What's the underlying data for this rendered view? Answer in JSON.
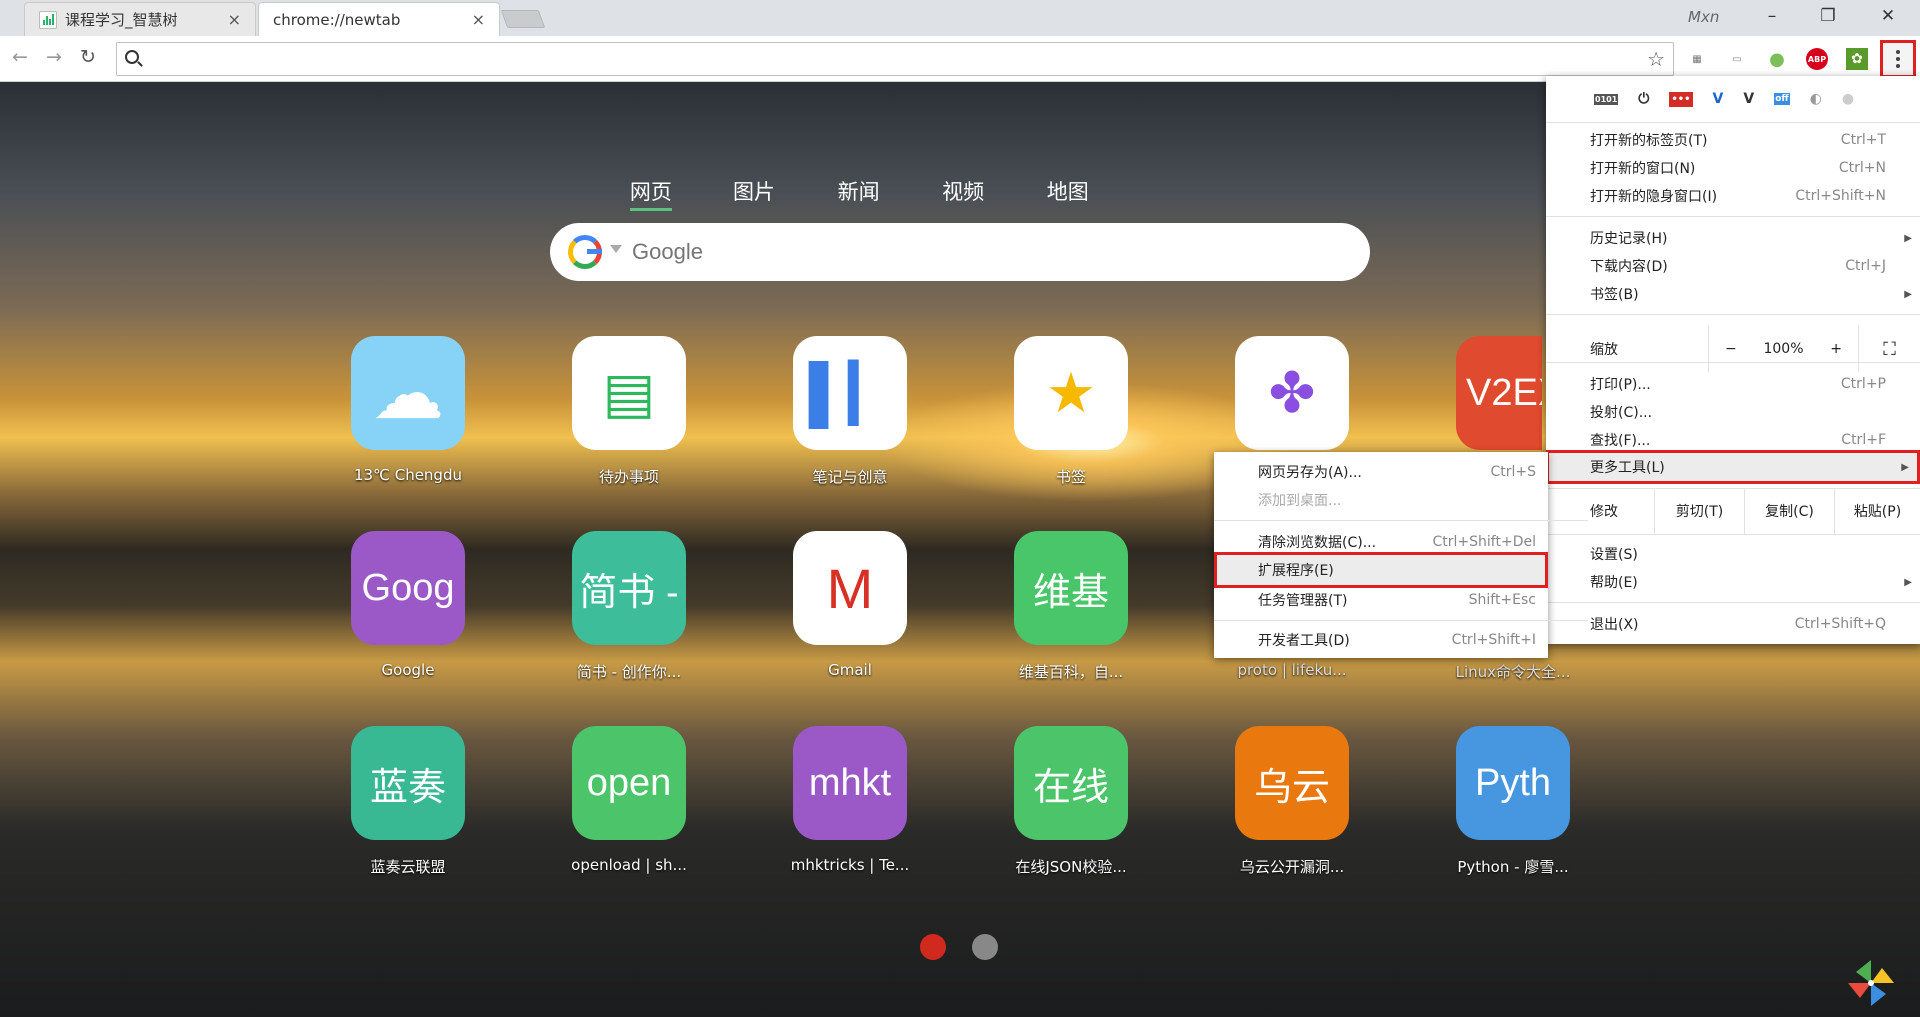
{
  "tabs": [
    {
      "title": "课程学习_智慧树",
      "close": "×"
    },
    {
      "title": "chrome://newtab",
      "close": "×"
    }
  ],
  "window": {
    "user": "Mxn",
    "minimize": "–",
    "restore": "❐",
    "close": "✕"
  },
  "toolbar": {
    "back": "←",
    "forward": "→",
    "reload": "↻",
    "address_value": "",
    "star": "☆",
    "extensions": [
      {
        "name": "reader-icon",
        "text": "▦",
        "color": "#777"
      },
      {
        "name": "window-icon",
        "text": "▭",
        "color": "#888"
      },
      {
        "name": "circle-extension-icon",
        "text": "●",
        "color": "#7cbf5a"
      },
      {
        "name": "adblock-plus-icon",
        "text": "ABP",
        "color": "#d6001c"
      },
      {
        "name": "bamboo-icon",
        "text": "✿",
        "color": "#5a9a2a"
      }
    ]
  },
  "search": {
    "tabs": [
      "网页",
      "图片",
      "新闻",
      "视频",
      "地图"
    ],
    "placeholder": "Google"
  },
  "tiles": [
    {
      "name": "weather-tile",
      "text": "☁",
      "label": "13℃ Chengdu",
      "bg": "#86d3f7"
    },
    {
      "name": "todo-tile",
      "text": "▤",
      "label": "待办事项",
      "bg": "#ffffff",
      "fg": "#2db85c"
    },
    {
      "name": "notes-tile",
      "text": "▌▎",
      "label": "笔记与创意",
      "bg": "#ffffff",
      "fg": "#3b7ee8"
    },
    {
      "name": "bookmarks-tile",
      "text": "★",
      "label": "书签",
      "bg": "#ffffff",
      "fg": "#f6b900"
    },
    {
      "name": "apps-tile",
      "text": "✤",
      "label": "",
      "bg": "#ffffff",
      "fg": "#8a4fe0"
    },
    {
      "name": "v2ex-tile",
      "text": "V2EX",
      "label": "",
      "bg": "#e04a2e"
    },
    {
      "name": "google-tile",
      "text": "Goog",
      "label": "Google",
      "bg": "#9a59c7"
    },
    {
      "name": "jianshu-tile",
      "text": "简书 -",
      "label": "简书 - 创作你...",
      "bg": "#3dbd9a"
    },
    {
      "name": "gmail-tile",
      "text": "M",
      "label": "Gmail",
      "bg": "#ffffff",
      "fg": "#d93025"
    },
    {
      "name": "wiki-tile",
      "text": "维基",
      "label": "维基百科，自...",
      "bg": "#49c66a"
    },
    {
      "name": "proto-tile",
      "text": "",
      "label": "proto | lifeku...",
      "bg": "transparent"
    },
    {
      "name": "linux-tile",
      "text": "",
      "label": "Linux命令大全...",
      "bg": "transparent"
    },
    {
      "name": "lanzou-tile",
      "text": "蓝奏",
      "label": "蓝奏云联盟",
      "bg": "#39b894"
    },
    {
      "name": "openload-tile",
      "text": "open",
      "label": "openload | sh...",
      "bg": "#4cc46a"
    },
    {
      "name": "mhkt-tile",
      "text": "mhkt",
      "label": "mhktricks | Te...",
      "bg": "#9a59c7"
    },
    {
      "name": "json-tile",
      "text": "在线",
      "label": "在线JSON校验...",
      "bg": "#4cc46a"
    },
    {
      "name": "wooyun-tile",
      "text": "乌云",
      "label": "乌云公开漏洞...",
      "bg": "#e9780e"
    },
    {
      "name": "python-tile",
      "text": "Pyth",
      "label": "Python - 廖雪...",
      "bg": "#4797e0"
    }
  ],
  "pager": {
    "active_color": "#d02a1f",
    "inactive_color": "#888888"
  },
  "menu": {
    "top_icons": [
      "0101",
      "⏻",
      "•••",
      "V",
      "V",
      "off",
      "◐",
      "●"
    ],
    "new_tab": {
      "label": "打开新的标签页(T)",
      "shortcut": "Ctrl+T"
    },
    "new_window": {
      "label": "打开新的窗口(N)",
      "shortcut": "Ctrl+N"
    },
    "incognito": {
      "label": "打开新的隐身窗口(I)",
      "shortcut": "Ctrl+Shift+N"
    },
    "history": {
      "label": "历史记录(H)"
    },
    "downloads": {
      "label": "下载内容(D)",
      "shortcut": "Ctrl+J"
    },
    "bookmarks": {
      "label": "书签(B)"
    },
    "zoom": {
      "label": "缩放",
      "minus": "−",
      "value": "100%",
      "plus": "+",
      "fullscreen": "⛶"
    },
    "print": {
      "label": "打印(P)...",
      "shortcut": "Ctrl+P"
    },
    "cast": {
      "label": "投射(C)..."
    },
    "find": {
      "label": "查找(F)...",
      "shortcut": "Ctrl+F"
    },
    "more_tools": {
      "label": "更多工具(L)"
    },
    "edit": {
      "label": "修改",
      "cut": "剪切(T)",
      "copy": "复制(C)",
      "paste": "粘贴(P)"
    },
    "settings": {
      "label": "设置(S)"
    },
    "help": {
      "label": "帮助(E)"
    },
    "exit": {
      "label": "退出(X)",
      "shortcut": "Ctrl+Shift+Q"
    }
  },
  "submenu": {
    "save_page": {
      "label": "网页另存为(A)...",
      "shortcut": "Ctrl+S"
    },
    "add_desktop": {
      "label": "添加到桌面..."
    },
    "clear_data": {
      "label": "清除浏览数据(C)...",
      "shortcut": "Ctrl+Shift+Del"
    },
    "extensions": {
      "label": "扩展程序(E)"
    },
    "task_manager": {
      "label": "任务管理器(T)",
      "shortcut": "Shift+Esc"
    },
    "dev_tools": {
      "label": "开发者工具(D)",
      "shortcut": "Ctrl+Shift+I"
    }
  }
}
